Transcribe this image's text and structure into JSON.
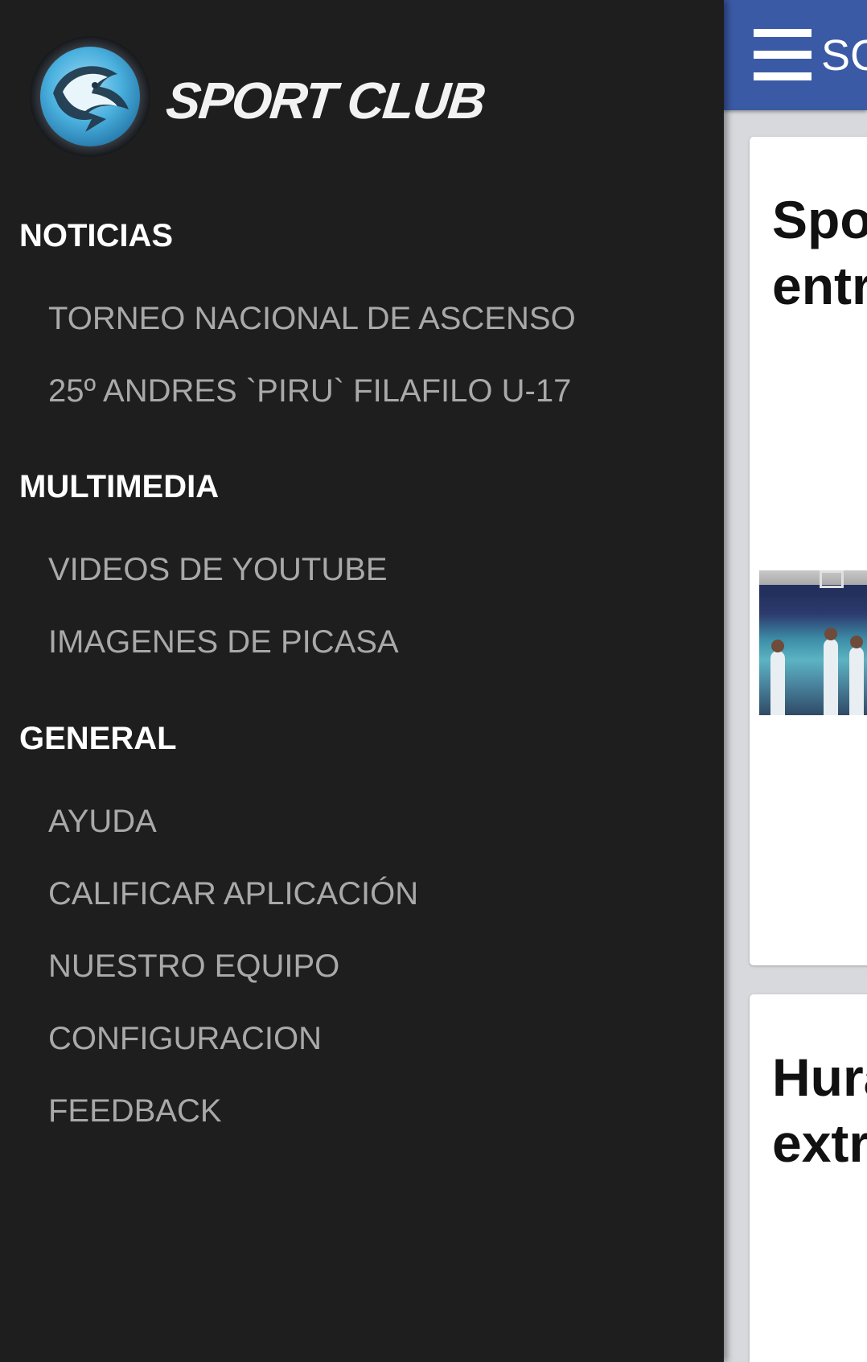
{
  "app": {
    "title_partial": "SC",
    "cards": [
      {
        "title_partial": "Spo\nentr"
      },
      {
        "title_partial": "Hura\nextr"
      }
    ]
  },
  "drawer": {
    "brand_name": "SPORT CLUB",
    "sections": [
      {
        "header": "NOTICIAS",
        "items": [
          "TORNEO NACIONAL DE ASCENSO",
          "25º ANDRES `PIRU` FILAFILO U-17"
        ]
      },
      {
        "header": "MULTIMEDIA",
        "items": [
          "VIDEOS DE YOUTUBE",
          "IMAGENES DE PICASA"
        ]
      },
      {
        "header": "GENERAL",
        "items": [
          "AYUDA",
          "CALIFICAR APLICACIÓN",
          "NUESTRO EQUIPO",
          "CONFIGURACION",
          "FEEDBACK"
        ]
      }
    ]
  },
  "icons": {
    "menu": "hamburger-menu-icon",
    "logo": "sport-club-logo"
  },
  "colors": {
    "drawer_background": "#1e1e1e",
    "toolbar": "#3b5aa6",
    "section_header": "#ffffff",
    "menu_item": "#a9a9a9",
    "logo_accent": "#5bb6e0"
  }
}
